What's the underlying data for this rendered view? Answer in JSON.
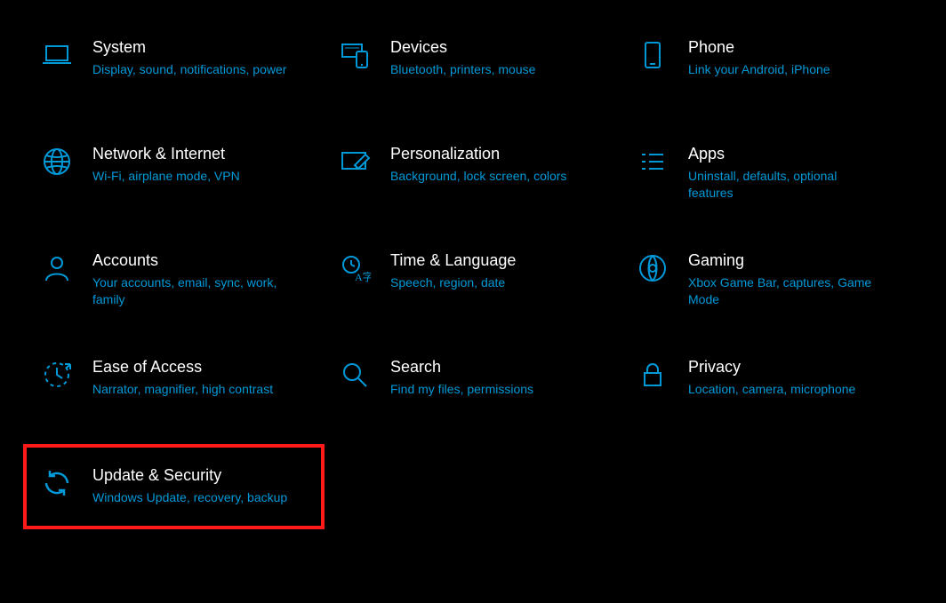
{
  "colors": {
    "accent": "#0099d8",
    "highlight_border": "#ff1a1a",
    "bg": "#000000"
  },
  "settings": {
    "items": [
      {
        "id": "system",
        "title": "System",
        "desc": "Display, sound, notifications, power",
        "icon": "laptop-icon",
        "highlighted": false
      },
      {
        "id": "devices",
        "title": "Devices",
        "desc": "Bluetooth, printers, mouse",
        "icon": "devices-icon",
        "highlighted": false
      },
      {
        "id": "phone",
        "title": "Phone",
        "desc": "Link your Android, iPhone",
        "icon": "phone-icon",
        "highlighted": false
      },
      {
        "id": "network",
        "title": "Network & Internet",
        "desc": "Wi-Fi, airplane mode, VPN",
        "icon": "globe-icon",
        "highlighted": false
      },
      {
        "id": "personalization",
        "title": "Personalization",
        "desc": "Background, lock screen, colors",
        "icon": "personalize-icon",
        "highlighted": false
      },
      {
        "id": "apps",
        "title": "Apps",
        "desc": "Uninstall, defaults, optional features",
        "icon": "apps-icon",
        "highlighted": false
      },
      {
        "id": "accounts",
        "title": "Accounts",
        "desc": "Your accounts, email, sync, work, family",
        "icon": "person-icon",
        "highlighted": false
      },
      {
        "id": "time",
        "title": "Time & Language",
        "desc": "Speech, region, date",
        "icon": "time-language-icon",
        "highlighted": false
      },
      {
        "id": "gaming",
        "title": "Gaming",
        "desc": "Xbox Game Bar, captures, Game Mode",
        "icon": "gaming-icon",
        "highlighted": false
      },
      {
        "id": "ease",
        "title": "Ease of Access",
        "desc": "Narrator, magnifier, high contrast",
        "icon": "ease-icon",
        "highlighted": false
      },
      {
        "id": "search",
        "title": "Search",
        "desc": "Find my files, permissions",
        "icon": "search-icon",
        "highlighted": false
      },
      {
        "id": "privacy",
        "title": "Privacy",
        "desc": "Location, camera, microphone",
        "icon": "lock-icon",
        "highlighted": false
      },
      {
        "id": "update",
        "title": "Update & Security",
        "desc": "Windows Update, recovery, backup",
        "icon": "update-icon",
        "highlighted": true
      }
    ]
  }
}
